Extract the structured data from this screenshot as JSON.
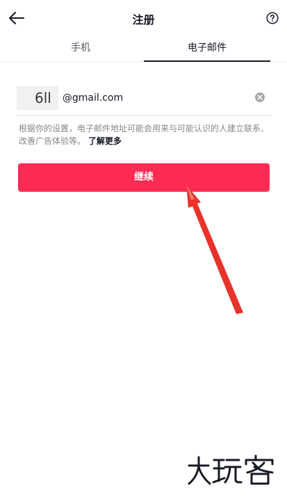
{
  "header": {
    "title": "注册"
  },
  "tabs": [
    {
      "label": "手机",
      "active": false
    },
    {
      "label": "电子邮件",
      "active": true
    }
  ],
  "email": {
    "local_part": "6ll",
    "domain": "@gmail.com"
  },
  "hint": {
    "text": "根据你的设置，电子邮件地址可能会用来与可能认识的人建立联系、改善广告体验等。",
    "link": "了解更多"
  },
  "continue_label": "继续",
  "colors": {
    "accent": "#fe2c55",
    "annotation_arrow": "#e8332a"
  },
  "watermark": {
    "text": "大玩客"
  }
}
